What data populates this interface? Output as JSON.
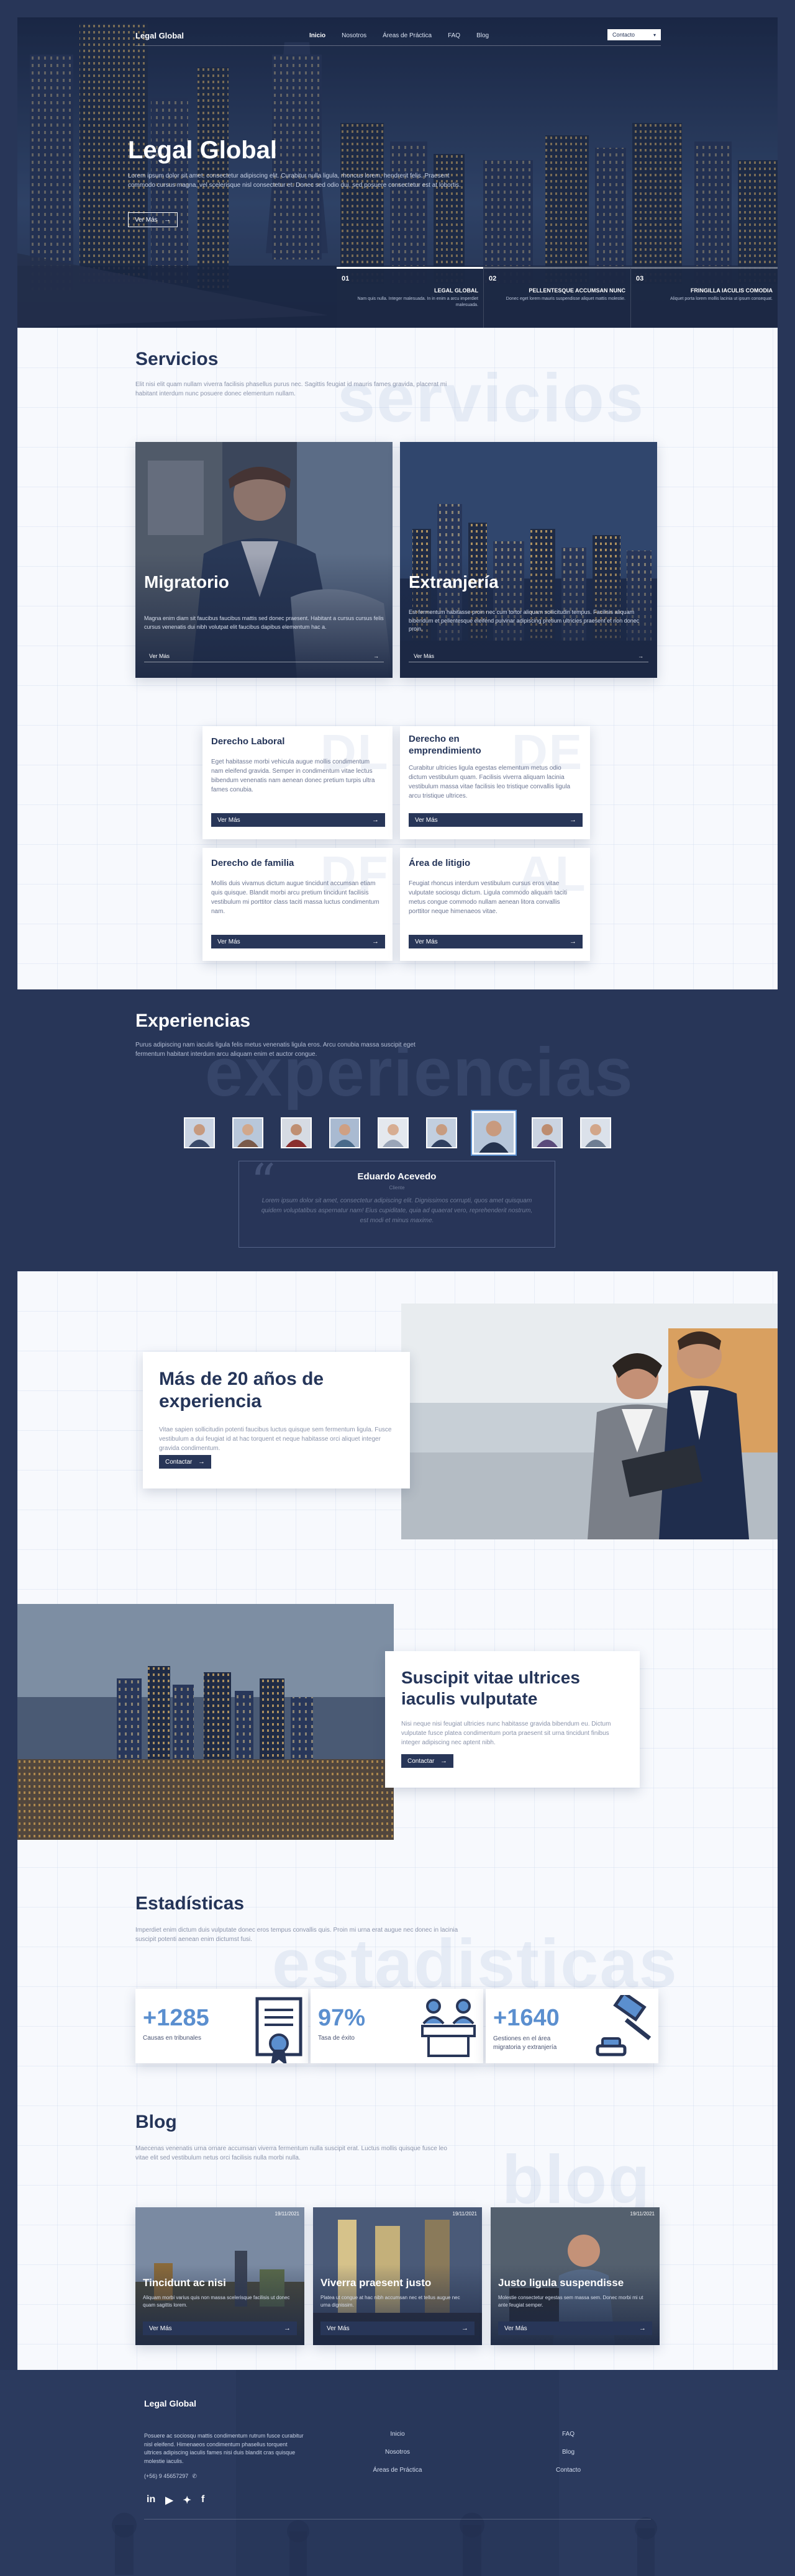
{
  "nav": {
    "logo": "Legal Global",
    "links": [
      "Inicio",
      "Nosotros",
      "Áreas de Práctica",
      "FAQ",
      "Blog"
    ],
    "contact": "Contacto"
  },
  "hero": {
    "title": "Legal Global",
    "text": "Lorem ipsum dolor sit amet, consectetur adipiscing elit. Curabitur nulla ligula, rhoncus lorem, hendrerit felis. Praesent commodo cursus magna, vel scelerisque nisl consectetur et. Donec sed odio dui, sed posuere consectetur est at lobortis.",
    "button": "Ver Más",
    "slides": [
      {
        "num": "01",
        "title": "LEGAL GLOBAL",
        "text": "Nam quis nulla. Integer malesuada. In in enim a arcu imperdiet malesuada."
      },
      {
        "num": "02",
        "title": "PELLENTESQUE ACCUMSAN NUNC",
        "text": "Donec eget lorem mauris suspendisse aliquet mattis molestie."
      },
      {
        "num": "03",
        "title": "FRINGILLA IACULIS COMODIA",
        "text": "Aliquet porta lorem mollis lacinia ut ipsum consequat."
      }
    ]
  },
  "servicios": {
    "title": "Servicios",
    "text": "Elit nisi elit quam nullam viverra facilisis phasellus purus nec. Sagittis feugiat id mauris fames gravida, placerat mi habitant interdum nunc posuere donec elementum nullam.",
    "watermark": "servicios",
    "big": [
      {
        "title": "Migratorio",
        "text": "Magna enim diam sit faucibus faucibus mattis sed donec praesent. Habitant a cursus cursus felis cursus venenatis dui nibh volutpat elit faucibus dapibus elementum hac a.",
        "button": "Ver Más"
      },
      {
        "title": "Extranjería",
        "text": "Est fermentum habitasse proin nec cum tortor aliquam sollicitudin tempus. Facilisis aliquam bibendum et pellentesque eleifend pulvinar adipiscing pretium ultricies praesent et non donec proin.",
        "button": "Ver Más"
      }
    ],
    "small": [
      {
        "title": "Derecho Laboral",
        "text": "Eget habitasse morbi vehicula augue mollis condimentum nam eleifend gravida. Semper in condimentum vitae lectus bibendum venenatis nam aenean donec pretium turpis ultra fames conubia.",
        "button": "Ver Más",
        "wm": "DL"
      },
      {
        "title": "Derecho en emprendimiento",
        "text": "Curabitur ultricies ligula egestas elementum metus odio dictum vestibulum quam. Facilisis viverra aliquam lacinia vestibulum massa vitae facilisis leo tristique convallis ligula arcu tristique ultrices.",
        "button": "Ver Más",
        "wm": "DE"
      },
      {
        "title": "Derecho de familia",
        "text": "Mollis duis vivamus dictum augue tincidunt accumsan etiam quis quisque. Blandit morbi arcu pretium tincidunt facilisis vestibulum mi porttitor class taciti massa luctus condimentum nam.",
        "button": "Ver Más",
        "wm": "DF"
      },
      {
        "title": "Área de litigio",
        "text": "Feugiat rhoncus interdum vestibulum cursus eros vitae vulputate sociosqu dictum. Ligula commodo aliquam taciti metus congue commodo nullam aenean litora convallis porttitor neque himenaeos vitae.",
        "button": "Ver Más",
        "wm": "AL"
      }
    ]
  },
  "experiencias": {
    "title": "Experiencias",
    "text": "Purus adipiscing nam iaculis ligula felis metus venenatis ligula eros. Arcu conubia massa suscipit eget fermentum habitant interdum arcu aliquam enim et auctor congue.",
    "watermark": "experiencias",
    "name": "Eduardo Acevedo",
    "role": "Cliente",
    "quote": "Lorem ipsum dolor sit amet, consectetur adipiscing elit. Dignissimos corrupti, quos amet quisquam quidem voluptatibus aspernatur nam! Eius cupiditate, quia ad quaerat vero, reprehenderit nostrum, est modi et minus maxime."
  },
  "about": [
    {
      "title": "Más de 20 años de experiencia",
      "text": "Vitae sapien sollicitudin potenti faucibus luctus quisque sem fermentum ligula. Fusce vestibulum a dui feugiat id at hac torquent et neque habitasse orci aliquet integer gravida condimentum.",
      "button": "Contactar"
    },
    {
      "title": "Suscipit vitae ultrices iaculis vulputate",
      "text": "Nisi neque nisi feugiat ultricies nunc habitasse gravida bibendum eu. Dictum vulputate fusce platea condimentum porta praesent sit urna tincidunt finibus integer adipiscing nec aptent nibh.",
      "button": "Contactar"
    }
  ],
  "estadisticas": {
    "title": "Estadísticas",
    "text": "Imperdiet enim dictum duis vulputate donec eros tempus convallis quis. Proin mi urna erat augue nec donec in lacinia suscipit potenti aenean enim dictumst fusi.",
    "watermark": "estadisticas",
    "items": [
      {
        "value": "+1285",
        "label": "Causas en tribunales",
        "icon": "certificate-icon"
      },
      {
        "value": "97%",
        "label": "Tasa de éxito",
        "icon": "people-icon"
      },
      {
        "value": "+1640",
        "label": "Gestiones en el área migratoria y extranjería",
        "icon": "gavel-icon"
      }
    ]
  },
  "blog": {
    "title": "Blog",
    "text": "Maecenas venenatis urna ornare accumsan viverra fermentum nulla suscipit erat. Luctus mollis quisque fusce leo vitae elit sed vestibulum netus orci facilisis nulla morbi nulla.",
    "watermark": "blog",
    "posts": [
      {
        "date": "19/11/2021",
        "title": "Tincidunt ac nisi",
        "text": "Aliquam morbi varius quis non massa scelerisque facilisis ut donec quam sagittis lorem.",
        "button": "Ver Más"
      },
      {
        "date": "19/11/2021",
        "title": "Viverra praesent justo",
        "text": "Platea ut congue at hac nibh accumsan nec et tellus augue nec urna dignissim.",
        "button": "Ver Más"
      },
      {
        "date": "19/11/2021",
        "title": "Justo ligula suspendisse",
        "text": "Molestie consectetur egestas sem massa sem. Donec morbi mi ut ante feugiat semper.",
        "button": "Ver Más"
      }
    ]
  },
  "footer": {
    "logo": "Legal Global",
    "text": "Posuere ac sociosqu mattis condimentum rutrum fusce curabitur nisl eleifend. Himenaeos condimentum phasellus torquent ultrices adipiscing iaculis fames nisi duis blandit cras quisque molestie iaculis.",
    "phone": "(+56) 9 45657297",
    "col1": [
      "Inicio",
      "Nosotros",
      "Áreas de Práctica"
    ],
    "col2": [
      "FAQ",
      "Blog",
      "Contacto"
    ],
    "social": [
      "linkedin-icon",
      "youtube-icon",
      "twitter-icon",
      "facebook-icon"
    ]
  },
  "colors": {
    "navy": "#283658",
    "accent": "#5b8fcf",
    "light": "#f5f8fc"
  }
}
